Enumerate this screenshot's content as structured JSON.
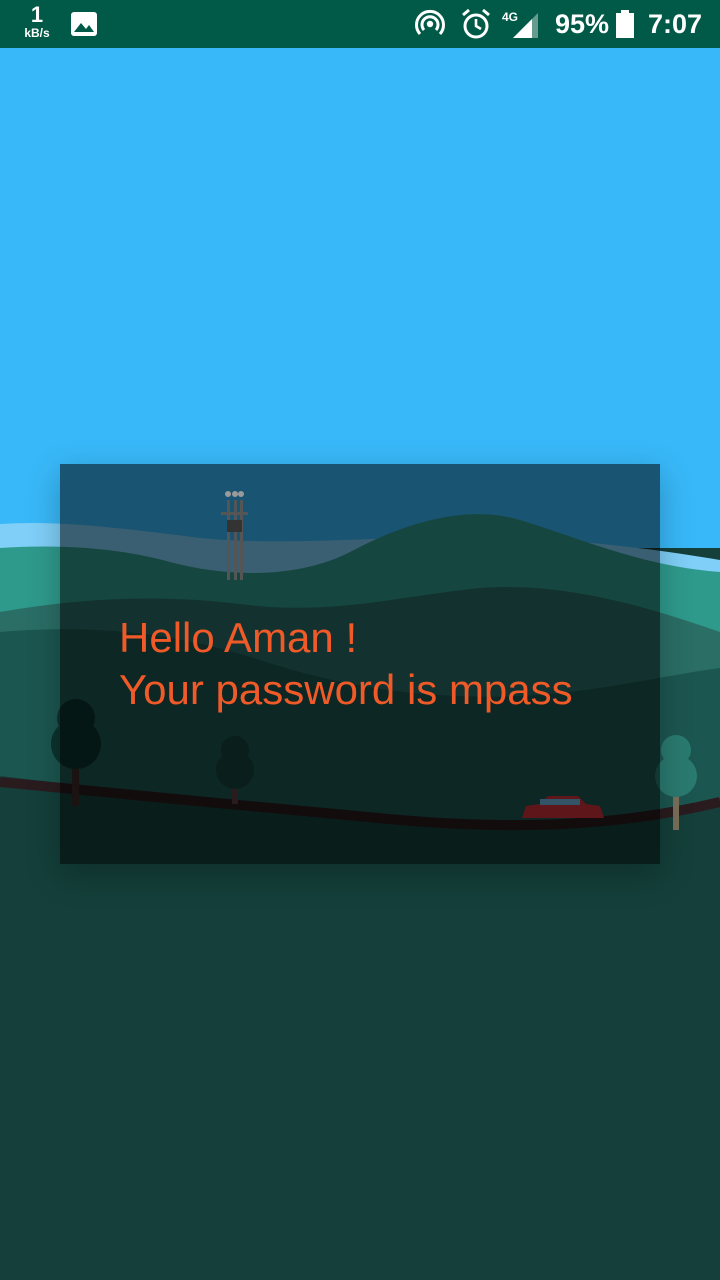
{
  "status_bar": {
    "net_speed_value": "1",
    "net_speed_unit": "kB/s",
    "network_type": "4G",
    "battery_percent": "95%",
    "time": "7:07",
    "color": "#005a47"
  },
  "colors": {
    "sky": "#38b8f8",
    "ground": "#143f3a",
    "message_text": "#f05a28"
  },
  "dialog": {
    "line1": "Hello Aman !",
    "line2": "Your password is mpass"
  },
  "icons": [
    "gallery-icon",
    "hotspot-icon",
    "alarm-icon",
    "signal-icon",
    "battery-icon"
  ]
}
